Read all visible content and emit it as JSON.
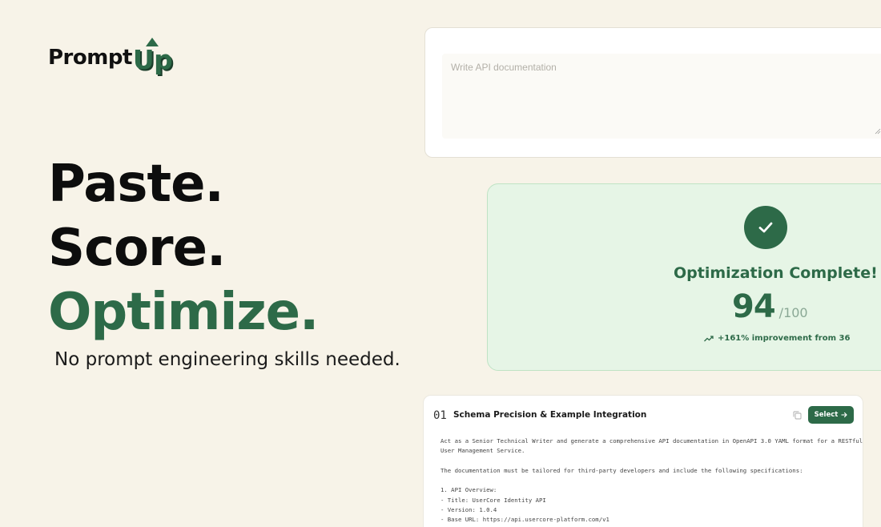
{
  "brand": {
    "name_part1": "Prompt",
    "name_part2": "Up",
    "accent": "#2d6a48"
  },
  "hero": {
    "line1": "Paste.",
    "line2": "Score.",
    "line3": "Optimize.",
    "tagline": "No prompt engineering skills needed."
  },
  "input": {
    "placeholder": "Write API documentation",
    "value": ""
  },
  "result": {
    "icon": "check-icon",
    "title": "Optimization Complete!",
    "score": "94",
    "max": "/100",
    "improvement": "+161% improvement from 36",
    "improvement_icon": "trending-up-icon"
  },
  "option": {
    "number": "01",
    "title": "Schema Precision & Example Integration",
    "copy_icon": "copy-icon",
    "select_label": "Select",
    "select_icon": "arrow-right-icon",
    "body_lines": [
      "Act as a Senior Technical Writer and generate a comprehensive API documentation in OpenAPI 3.0 YAML format for a RESTful",
      "User Management Service.",
      "",
      "The documentation must be tailored for third-party developers and include the following specifications:",
      "",
      "1. API Overview:",
      "- Title: UserCore Identity API",
      "- Version: 1.0.4",
      "- Base URL: https://api.usercore-platform.com/v1"
    ]
  }
}
